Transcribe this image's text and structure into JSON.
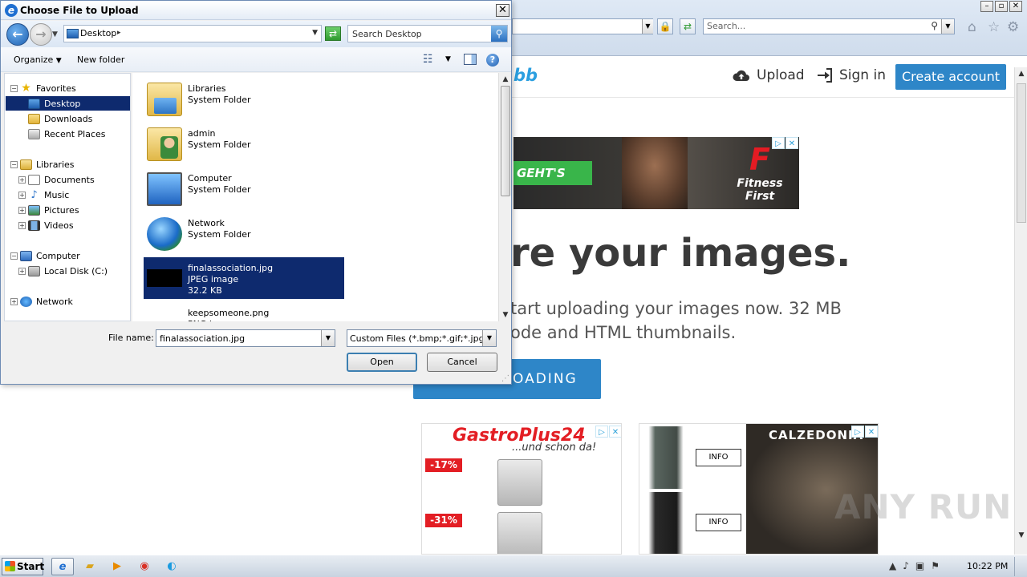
{
  "browser": {
    "search_placeholder": "Search...",
    "tool_icons": [
      "home-icon",
      "star-icon",
      "gear-icon"
    ]
  },
  "site": {
    "logo_fragment": "bb",
    "upload_label": "Upload",
    "signin_label": "Sign in",
    "create_account_label": "Create account",
    "hero_title_fragment": "re your images.",
    "hero_sub_line1": "tart uploading your images now. 32 MB",
    "hero_sub_line2": "ode and HTML thumbnails.",
    "start_button_fragment": "OADING",
    "accent_color": "#2e86c8"
  },
  "ads": {
    "top": {
      "slogan_fragment": "GEHT'S",
      "logo_letter": "F",
      "brand": "Fitness First"
    },
    "gastro": {
      "brand": "GastroPlus24",
      "tagline": "...und schon da!",
      "discounts": [
        "-17%",
        "-31%"
      ]
    },
    "calzedonia": {
      "brand": "CALZEDONIA",
      "info_labels": [
        "INFO",
        "INFO"
      ]
    }
  },
  "watermark": "ANY RUN",
  "dialog": {
    "title": "Choose File to Upload",
    "close_label": "✕",
    "address": "Desktop",
    "search_placeholder": "Search Desktop",
    "toolbar": {
      "organize_label": "Organize",
      "new_folder_label": "New folder"
    },
    "nav": [
      {
        "label": "Favorites",
        "icon": "favorites-star-icon"
      },
      {
        "label": "Desktop",
        "icon": "desktop-icon",
        "selected": true
      },
      {
        "label": "Downloads",
        "icon": "downloads-folder-icon"
      },
      {
        "label": "Recent Places",
        "icon": "recent-places-icon"
      },
      {
        "label": "Libraries",
        "icon": "libraries-icon"
      },
      {
        "label": "Documents",
        "icon": "documents-icon"
      },
      {
        "label": "Music",
        "icon": "music-icon"
      },
      {
        "label": "Pictures",
        "icon": "pictures-icon"
      },
      {
        "label": "Videos",
        "icon": "videos-icon"
      },
      {
        "label": "Computer",
        "icon": "computer-icon"
      },
      {
        "label": "Local Disk (C:)",
        "icon": "local-disk-icon"
      },
      {
        "label": "Network",
        "icon": "network-icon"
      }
    ],
    "files": [
      {
        "name": "Libraries",
        "type": "System Folder",
        "size": "",
        "icon": "libraries-folder-icon"
      },
      {
        "name": "admin",
        "type": "System Folder",
        "size": "",
        "icon": "user-folder-icon"
      },
      {
        "name": "Computer",
        "type": "System Folder",
        "size": "",
        "icon": "computer-icon"
      },
      {
        "name": "Network",
        "type": "System Folder",
        "size": "",
        "icon": "network-globe-icon"
      },
      {
        "name": "finalassociation.jpg",
        "type": "JPEG image",
        "size": "32.2 KB",
        "icon": "jpeg-thumbnail-icon",
        "selected": true
      },
      {
        "name": "keepsomeone.png",
        "type": "PNG i",
        "size": "",
        "icon": "png-thumbnail-icon"
      }
    ],
    "file_name_label": "File name:",
    "file_name_value": "finalassociation.jpg",
    "filter_value": "Custom Files (*.bmp;*.gif;*.jpg;",
    "open_label": "Open",
    "cancel_label": "Cancel"
  },
  "taskbar": {
    "start_label": "Start",
    "apps": [
      "ie-icon",
      "explorer-folder-icon",
      "media-player-icon",
      "chrome-icon",
      "edge-icon"
    ],
    "clock": "10:22 PM"
  }
}
